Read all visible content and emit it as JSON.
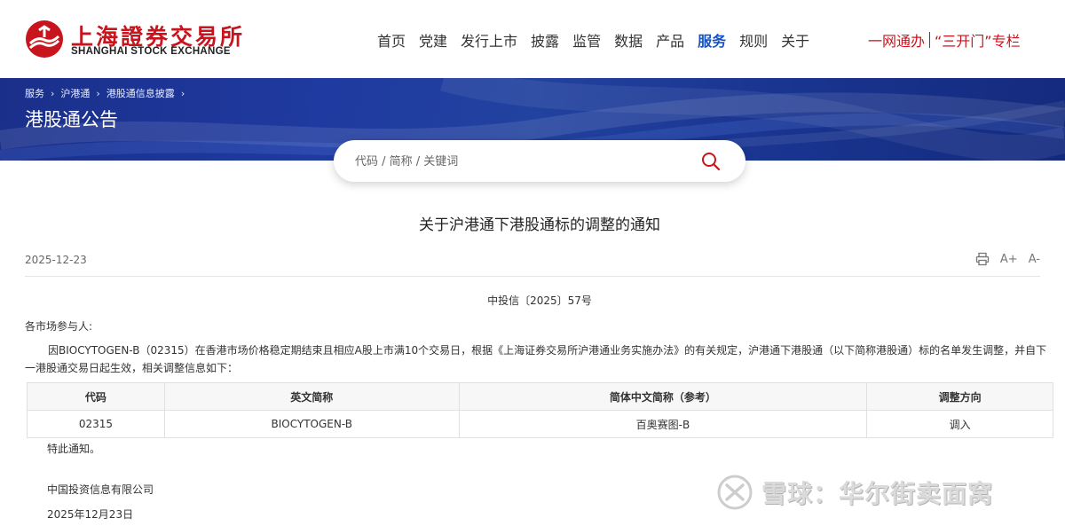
{
  "header": {
    "logo_cn": "上海證券交易所",
    "logo_en": "SHANGHAI STOCK EXCHANGE",
    "nav": [
      "首页",
      "党建",
      "发行上市",
      "披露",
      "监管",
      "数据",
      "产品",
      "服务",
      "规则",
      "关于"
    ],
    "nav_active": "服务",
    "quick_links": [
      "一网通办",
      "“三开门”专栏"
    ]
  },
  "banner": {
    "breadcrumbs": [
      "服务",
      "沪港通",
      "港股通信息披露"
    ],
    "title": "港股通公告"
  },
  "search": {
    "placeholder": "代码 / 简称 / 关键词",
    "icon": "search-icon"
  },
  "article": {
    "title": "关于沪港通下港股通标的调整的通知",
    "date": "2025-12-23",
    "tools": {
      "print_icon": "print-icon",
      "font_increase": "A+",
      "font_decrease": "A-"
    },
    "doc_no": "中投信〔2025〕57号",
    "greeting": "各市场参与人:",
    "body": "因BIOCYTOGEN-B（02315）在香港市场价格稳定期结束且相应A股上市满10个交易日，根据《上海证券交易所沪港通业务实施办法》的有关规定，沪港通下港股通（以下简称港股通）标的名单发生调整，并自下一港股通交易日起生效，相关调整信息如下：",
    "table": {
      "headers": [
        "代码",
        "英文简称",
        "简体中文简称（参考）",
        "调整方向"
      ],
      "rows": [
        [
          "02315",
          "BIOCYTOGEN-B",
          "百奥赛图-B",
          "调入"
        ]
      ]
    },
    "closing": "特此通知。",
    "issuer": "中国投资信息有限公司",
    "issue_date": "2025年12月23日"
  },
  "watermark": {
    "text": "雪球：华尔街卖面窝"
  },
  "colors": {
    "brand_red": "#c8141d",
    "nav_active": "#1552c4",
    "banner_blue": "#1f3aa0"
  }
}
